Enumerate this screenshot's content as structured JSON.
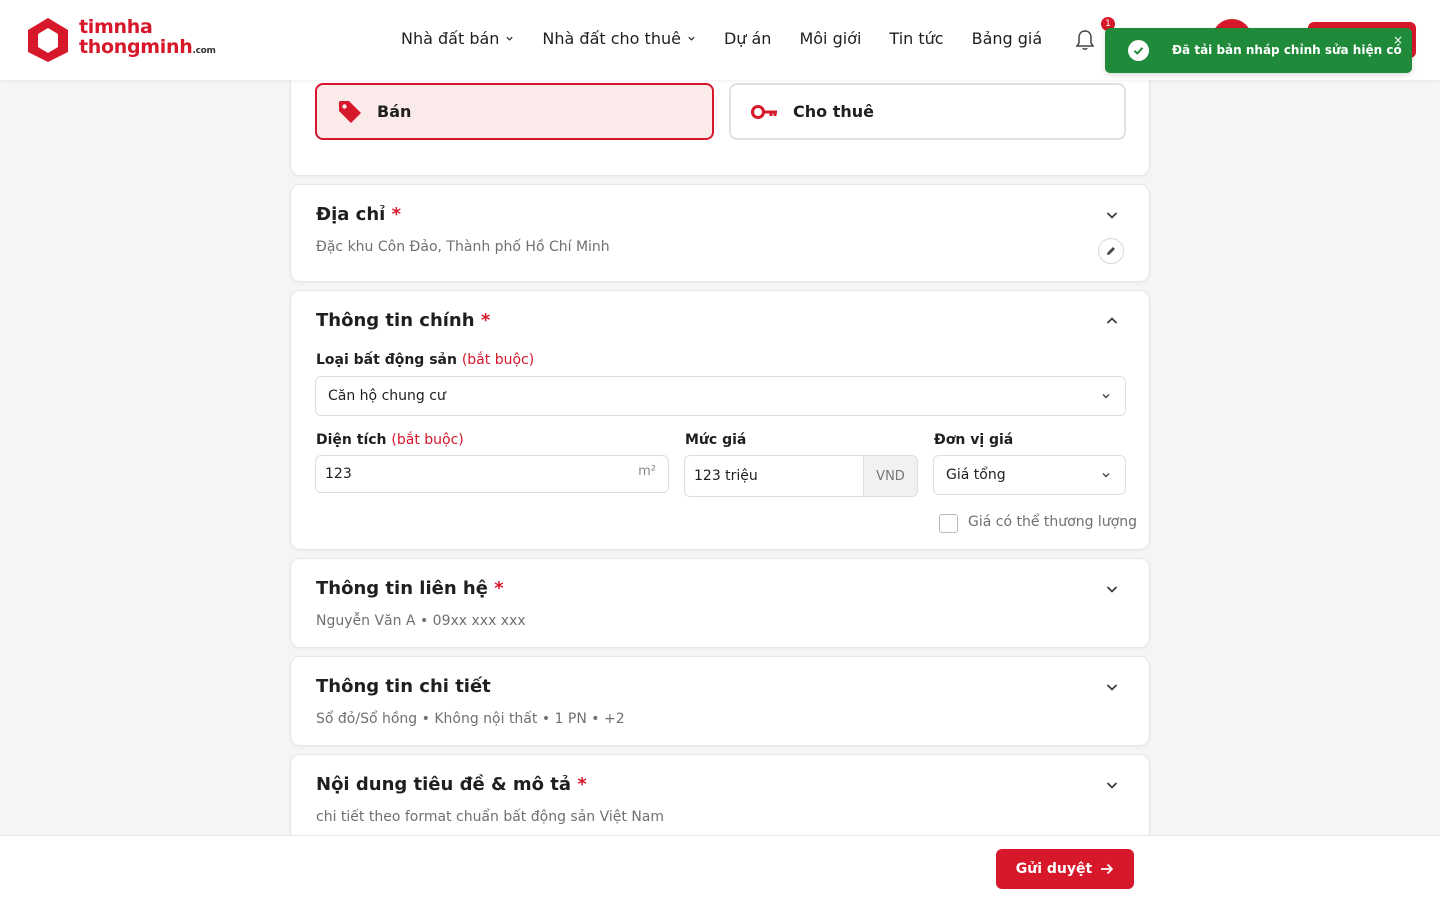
{
  "header": {
    "logo_line1": "timnha",
    "logo_line2": "thongminh",
    "logo_suffix": ".com",
    "nav": [
      {
        "label": "Nhà đất bán",
        "has_dropdown": true
      },
      {
        "label": "Nhà đất cho thuê",
        "has_dropdown": true
      },
      {
        "label": "Dự án",
        "has_dropdown": false
      },
      {
        "label": "Môi giới",
        "has_dropdown": false
      },
      {
        "label": "Tin tức",
        "has_dropdown": false
      },
      {
        "label": "Bảng giá",
        "has_dropdown": false
      }
    ],
    "notification_count": "1",
    "brand_color": "#d7182a"
  },
  "toast": {
    "message": "Đã tải bản nháp chỉnh sửa hiện có",
    "close": "×",
    "color": "#1e8a3a"
  },
  "listing_type": {
    "sale_label": "Bán",
    "rent_label": "Cho thuê",
    "selected": "sale"
  },
  "address": {
    "title": "Địa chỉ",
    "required_mark": "*",
    "summary": "Đặc khu Côn Đảo, Thành phố Hồ Chí Minh"
  },
  "main_info": {
    "title": "Thông tin chính",
    "required_mark": "*",
    "property_type_label": "Loại bất động sản",
    "property_type_hint": "(bắt buộc)",
    "property_type_value": "Căn hộ chung cư",
    "area_label": "Diện tích",
    "area_hint": "(bắt buộc)",
    "area_value": "123",
    "area_unit": "m²",
    "price_label": "Mức giá",
    "price_value": "123 triệu",
    "price_currency": "VND",
    "price_unit_label": "Đơn vị giá",
    "price_unit_value": "Giá tổng",
    "negotiable_label": "Giá có thể thương lượng",
    "negotiable_checked": false
  },
  "contact": {
    "title": "Thông tin liên hệ",
    "required_mark": "*",
    "summary": "Nguyễn Văn A • 09xx xxx xxx"
  },
  "details": {
    "title": "Thông tin chi tiết",
    "summary": "Sổ đỏ/Sổ hồng • Không nội thất • 1 PN • +2"
  },
  "content": {
    "title": "Nội dung tiêu đề & mô tả",
    "required_mark": "*",
    "summary": "chi tiết theo format chuẩn bất động sản Việt Nam"
  },
  "footer": {
    "submit_label": "Gửi duyệt"
  }
}
